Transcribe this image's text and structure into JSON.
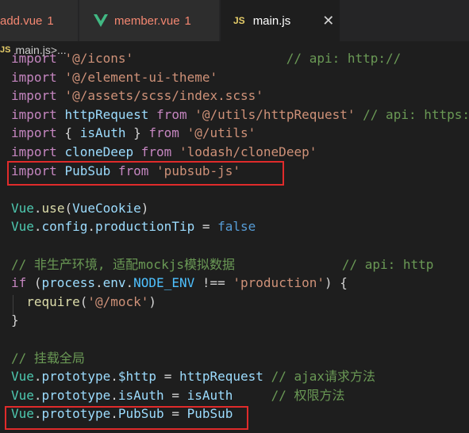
{
  "tabs": [
    {
      "label": "add.vue",
      "badge": "1",
      "icon": "vue-icon"
    },
    {
      "label": "member.vue",
      "badge": "1",
      "icon": "vue-icon"
    },
    {
      "label": "main.js",
      "icon": "js-icon",
      "icon_text": "JS",
      "close": "✕"
    }
  ],
  "breadcrumb": {
    "icon_text": "JS",
    "file": "main.js",
    "sep": " > ",
    "more": "..."
  },
  "code_lines": [
    {
      "segs": [
        [
          "kw",
          "import"
        ],
        [
          "txt",
          " "
        ],
        [
          "str",
          "'@/icons'"
        ],
        [
          "txt",
          "                    "
        ],
        [
          "cm",
          "// api: http://"
        ]
      ]
    },
    {
      "segs": [
        [
          "kw",
          "import"
        ],
        [
          "txt",
          " "
        ],
        [
          "str",
          "'@/element-ui-theme'"
        ]
      ]
    },
    {
      "segs": [
        [
          "kw",
          "import"
        ],
        [
          "txt",
          " "
        ],
        [
          "str",
          "'@/assets/scss/index.scss'"
        ]
      ]
    },
    {
      "segs": [
        [
          "kw",
          "import"
        ],
        [
          "txt",
          " "
        ],
        [
          "id",
          "httpRequest"
        ],
        [
          "txt",
          " "
        ],
        [
          "kw",
          "from"
        ],
        [
          "txt",
          " "
        ],
        [
          "str",
          "'@/utils/httpRequest'"
        ],
        [
          "txt",
          " "
        ],
        [
          "cm",
          "// api: https:"
        ]
      ]
    },
    {
      "segs": [
        [
          "kw",
          "import"
        ],
        [
          "txt",
          " { "
        ],
        [
          "id",
          "isAuth"
        ],
        [
          "txt",
          " } "
        ],
        [
          "kw",
          "from"
        ],
        [
          "txt",
          " "
        ],
        [
          "str",
          "'@/utils'"
        ]
      ]
    },
    {
      "segs": [
        [
          "kw",
          "import"
        ],
        [
          "txt",
          " "
        ],
        [
          "id",
          "cloneDeep"
        ],
        [
          "txt",
          " "
        ],
        [
          "kw",
          "from"
        ],
        [
          "txt",
          " "
        ],
        [
          "str",
          "'lodash/cloneDeep'"
        ]
      ]
    },
    {
      "segs": [
        [
          "kw",
          "import"
        ],
        [
          "txt",
          " "
        ],
        [
          "id",
          "PubSub"
        ],
        [
          "txt",
          " "
        ],
        [
          "kw",
          "from"
        ],
        [
          "txt",
          " "
        ],
        [
          "str",
          "'pubsub-js'"
        ]
      ]
    },
    {
      "segs": []
    },
    {
      "segs": [
        [
          "cls",
          "Vue"
        ],
        [
          "txt",
          "."
        ],
        [
          "fn",
          "use"
        ],
        [
          "txt",
          "("
        ],
        [
          "id",
          "VueCookie"
        ],
        [
          "txt",
          ")"
        ]
      ]
    },
    {
      "segs": [
        [
          "cls",
          "Vue"
        ],
        [
          "txt",
          "."
        ],
        [
          "id",
          "config"
        ],
        [
          "txt",
          "."
        ],
        [
          "id",
          "productionTip"
        ],
        [
          "txt",
          " = "
        ],
        [
          "bool",
          "false"
        ]
      ]
    },
    {
      "segs": []
    },
    {
      "segs": [
        [
          "cm",
          "// 非生产环境, 适配mockjs模拟数据"
        ],
        [
          "txt",
          "              "
        ],
        [
          "cm",
          "// api: http"
        ]
      ]
    },
    {
      "segs": [
        [
          "kw",
          "if"
        ],
        [
          "txt",
          " ("
        ],
        [
          "id",
          "process"
        ],
        [
          "txt",
          "."
        ],
        [
          "id",
          "env"
        ],
        [
          "txt",
          "."
        ],
        [
          "const",
          "NODE_ENV"
        ],
        [
          "txt",
          " !== "
        ],
        [
          "str",
          "'production'"
        ],
        [
          "txt",
          ") {"
        ]
      ]
    },
    {
      "segs": [
        [
          "txt",
          "  "
        ],
        [
          "fn",
          "require"
        ],
        [
          "txt",
          "("
        ],
        [
          "str",
          "'@/mock'"
        ],
        [
          "txt",
          ")"
        ]
      ]
    },
    {
      "segs": [
        [
          "txt",
          "}"
        ]
      ]
    },
    {
      "segs": []
    },
    {
      "segs": [
        [
          "cm",
          "// 挂载全局"
        ]
      ]
    },
    {
      "segs": [
        [
          "cls",
          "Vue"
        ],
        [
          "txt",
          "."
        ],
        [
          "id",
          "prototype"
        ],
        [
          "txt",
          "."
        ],
        [
          "id",
          "$http"
        ],
        [
          "txt",
          " = "
        ],
        [
          "id",
          "httpRequest"
        ],
        [
          "txt",
          " "
        ],
        [
          "cm",
          "// ajax请求方法"
        ]
      ]
    },
    {
      "segs": [
        [
          "cls",
          "Vue"
        ],
        [
          "txt",
          "."
        ],
        [
          "id",
          "prototype"
        ],
        [
          "txt",
          "."
        ],
        [
          "id",
          "isAuth"
        ],
        [
          "txt",
          " = "
        ],
        [
          "id",
          "isAuth"
        ],
        [
          "txt",
          "     "
        ],
        [
          "cm",
          "// 权限方法"
        ]
      ]
    },
    {
      "segs": [
        [
          "cls",
          "Vue"
        ],
        [
          "txt",
          "."
        ],
        [
          "id",
          "prototype"
        ],
        [
          "txt",
          "."
        ],
        [
          "id",
          "PubSub"
        ],
        [
          "txt",
          " = "
        ],
        [
          "id",
          "PubSub"
        ]
      ]
    }
  ]
}
